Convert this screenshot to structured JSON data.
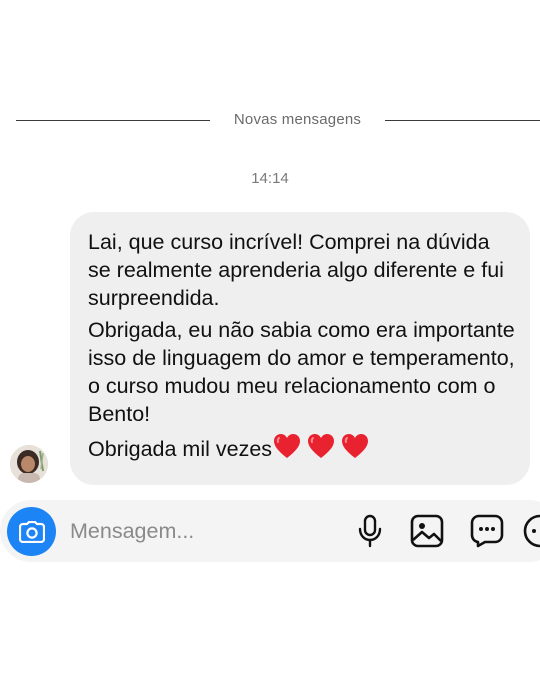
{
  "divider": {
    "label": "Novas mensagens"
  },
  "timestamp": "14:14",
  "message": {
    "paragraph1": "Lai, que curso incrível! Comprei na dúvida se realmente aprenderia algo diferente e fui surpreendida.",
    "paragraph2": "Obrigada, eu não sabia como era importante isso de linguagem do amor e temperamento, o curso mudou meu relacionamento com o Bento!",
    "paragraph3": "Obrigada mil vezes",
    "heart_count": 3,
    "heart_color": "#e8232f"
  },
  "composer": {
    "placeholder": "Mensagem...",
    "camera_icon": "camera-icon",
    "tools": [
      "microphone-icon",
      "image-icon",
      "sticker-chat-icon",
      "more-icon"
    ]
  },
  "colors": {
    "bubble": "#efefef",
    "accent": "#1d84f5",
    "composer_bg": "#f4f4f4"
  }
}
